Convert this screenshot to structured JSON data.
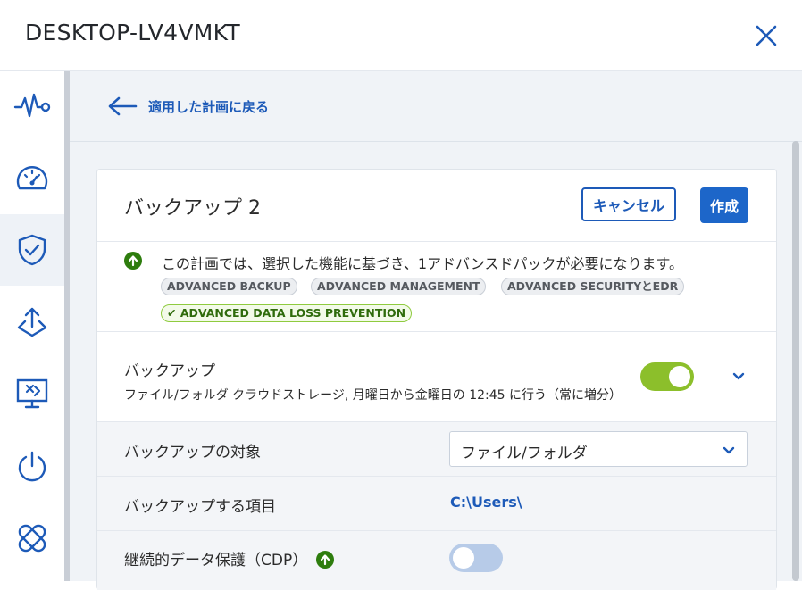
{
  "window": {
    "title": "DESKTOP-LV4VMKT",
    "close_icon": "close-icon"
  },
  "sidebar": {
    "items": [
      {
        "name": "monitoring",
        "icon": "pulse-icon",
        "active": false
      },
      {
        "name": "dashboard",
        "icon": "gauge-icon",
        "active": false
      },
      {
        "name": "protection",
        "icon": "shield-check-icon",
        "active": true
      },
      {
        "name": "deployment",
        "icon": "deploy-icon",
        "active": false
      },
      {
        "name": "remote-desktop",
        "icon": "remote-screen-icon",
        "active": false
      },
      {
        "name": "power",
        "icon": "power-icon",
        "active": false
      },
      {
        "name": "patch",
        "icon": "bandage-icon",
        "active": false
      }
    ]
  },
  "back_link": {
    "label": "適用した計画に戻る"
  },
  "plan": {
    "title": "バックアップ 2",
    "cancel_label": "キャンセル",
    "create_label": "作成",
    "notice": "この計画では、選択した機能に基づき、1アドバンスドパックが必要になります。",
    "badges": [
      {
        "label": "ADVANCED BACKUP"
      },
      {
        "label": "ADVANCED MANAGEMENT"
      },
      {
        "label": "ADVANCED SECURITYとEDR"
      },
      {
        "label": "✔ ADVANCED DATA LOSS PREVENTION"
      }
    ],
    "backup": {
      "label": "バックアップ",
      "summary": "ファイル/フォルダ クラウドストレージ, 月曜日から金曜日の 12:45 に行う（常に増分）",
      "enabled": true
    },
    "rows": {
      "target_label": "バックアップの対象",
      "target_value": "ファイル/フォルダ",
      "items_label": "バックアップする項目",
      "items_value": "C:\\Users\\",
      "cdp_label": "継続的データ保護（CDP）",
      "cdp_enabled": false
    }
  },
  "colors": {
    "accent": "#1d5ab8",
    "toggle_on": "#8cbf2b",
    "toggle_off": "#b7cbe8",
    "upgrade_green": "#2e7d0e"
  }
}
